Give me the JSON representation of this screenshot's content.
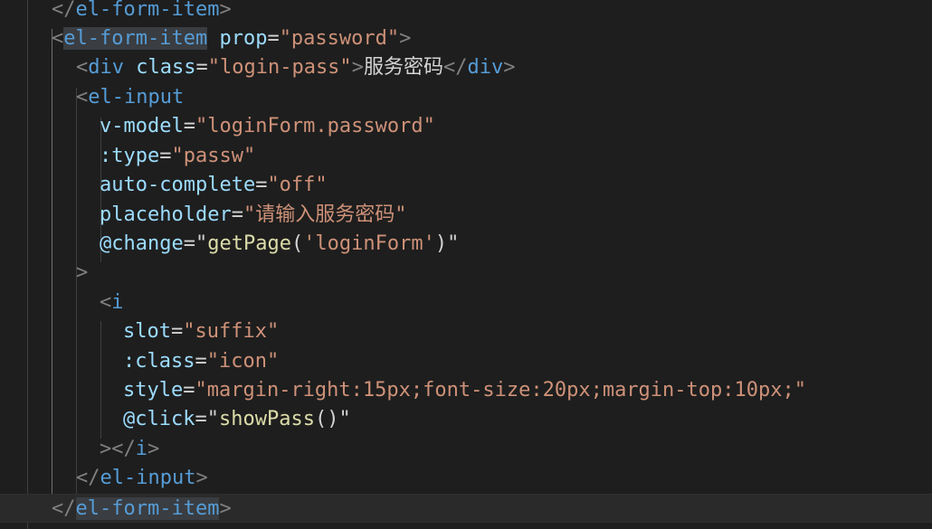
{
  "editor": {
    "theme_colors": {
      "background": "#1e1e1e",
      "tag": "#569cd6",
      "attribute": "#9cdcfe",
      "string": "#ce9178",
      "function": "#dcdcaa",
      "punctuation": "#808080",
      "text": "#d4d4d4"
    },
    "lines": [
      {
        "id": "l1",
        "segments": [
          {
            "t": "</",
            "c": "punc"
          },
          {
            "t": "el-form-item",
            "c": "tag"
          },
          {
            "t": ">",
            "c": "punc"
          }
        ]
      },
      {
        "id": "l2",
        "segments": [
          {
            "t": "<",
            "c": "punc"
          },
          {
            "t": "el-form-item",
            "c": "tag",
            "h": true
          },
          {
            "t": " ",
            "c": "txt"
          },
          {
            "t": "prop",
            "c": "attr"
          },
          {
            "t": "=",
            "c": "txt"
          },
          {
            "t": "\"password\"",
            "c": "str"
          },
          {
            "t": ">",
            "c": "punc"
          }
        ]
      },
      {
        "id": "l3",
        "segments": [
          {
            "t": "<",
            "c": "punc"
          },
          {
            "t": "div",
            "c": "tag"
          },
          {
            "t": " ",
            "c": "txt"
          },
          {
            "t": "class",
            "c": "attr"
          },
          {
            "t": "=",
            "c": "txt"
          },
          {
            "t": "\"login-pass\"",
            "c": "str"
          },
          {
            "t": ">",
            "c": "punc"
          },
          {
            "t": "服务密码",
            "c": "txt cjk"
          },
          {
            "t": "</",
            "c": "punc"
          },
          {
            "t": "div",
            "c": "tag"
          },
          {
            "t": ">",
            "c": "punc"
          }
        ]
      },
      {
        "id": "l4",
        "segments": [
          {
            "t": "<",
            "c": "punc"
          },
          {
            "t": "el-input",
            "c": "tag"
          }
        ]
      },
      {
        "id": "l5",
        "segments": [
          {
            "t": "v-model",
            "c": "attr"
          },
          {
            "t": "=",
            "c": "txt"
          },
          {
            "t": "\"loginForm.password\"",
            "c": "str"
          }
        ]
      },
      {
        "id": "l6",
        "segments": [
          {
            "t": ":type",
            "c": "attr"
          },
          {
            "t": "=",
            "c": "txt"
          },
          {
            "t": "\"passw\"",
            "c": "str"
          }
        ]
      },
      {
        "id": "l7",
        "segments": [
          {
            "t": "auto-complete",
            "c": "attr"
          },
          {
            "t": "=",
            "c": "txt"
          },
          {
            "t": "\"off\"",
            "c": "str"
          }
        ]
      },
      {
        "id": "l8",
        "segments": [
          {
            "t": "placeholder",
            "c": "attr"
          },
          {
            "t": "=",
            "c": "txt"
          },
          {
            "t": "\"",
            "c": "str"
          },
          {
            "t": "请输入服务密码",
            "c": "str cjk"
          },
          {
            "t": "\"",
            "c": "str"
          }
        ]
      },
      {
        "id": "l9",
        "segments": [
          {
            "t": "@change",
            "c": "attr"
          },
          {
            "t": "=",
            "c": "txt"
          },
          {
            "t": "\"",
            "c": "txt"
          },
          {
            "t": "getPage",
            "c": "fn"
          },
          {
            "t": "(",
            "c": "txt"
          },
          {
            "t": "'loginForm'",
            "c": "str"
          },
          {
            "t": ")\"",
            "c": "txt"
          }
        ]
      },
      {
        "id": "l10",
        "segments": [
          {
            "t": ">",
            "c": "punc"
          }
        ]
      },
      {
        "id": "l11",
        "segments": [
          {
            "t": "<",
            "c": "punc"
          },
          {
            "t": "i",
            "c": "tag"
          }
        ]
      },
      {
        "id": "l12",
        "segments": [
          {
            "t": "slot",
            "c": "attr"
          },
          {
            "t": "=",
            "c": "txt"
          },
          {
            "t": "\"suffix\"",
            "c": "str"
          }
        ]
      },
      {
        "id": "l13",
        "segments": [
          {
            "t": ":class",
            "c": "attr"
          },
          {
            "t": "=",
            "c": "txt"
          },
          {
            "t": "\"icon\"",
            "c": "str"
          }
        ]
      },
      {
        "id": "l14",
        "segments": [
          {
            "t": "style",
            "c": "attr"
          },
          {
            "t": "=",
            "c": "txt"
          },
          {
            "t": "\"margin-right:15px;font-size:20px;margin-top:10px;\"",
            "c": "str"
          }
        ]
      },
      {
        "id": "l15",
        "segments": [
          {
            "t": "@click",
            "c": "attr"
          },
          {
            "t": "=",
            "c": "txt"
          },
          {
            "t": "\"",
            "c": "txt"
          },
          {
            "t": "showPass",
            "c": "fn"
          },
          {
            "t": "()\"",
            "c": "txt"
          }
        ]
      },
      {
        "id": "l16",
        "segments": [
          {
            "t": "></",
            "c": "punc"
          },
          {
            "t": "i",
            "c": "tag"
          },
          {
            "t": ">",
            "c": "punc"
          }
        ]
      },
      {
        "id": "l17",
        "segments": [
          {
            "t": "</",
            "c": "punc"
          },
          {
            "t": "el-input",
            "c": "tag"
          },
          {
            "t": ">",
            "c": "punc"
          }
        ]
      },
      {
        "id": "l18",
        "segments": [
          {
            "t": "</",
            "c": "punc"
          },
          {
            "t": "el-form-item",
            "c": "tag",
            "h": true
          },
          {
            "t": ">",
            "c": "punc"
          }
        ]
      }
    ]
  }
}
